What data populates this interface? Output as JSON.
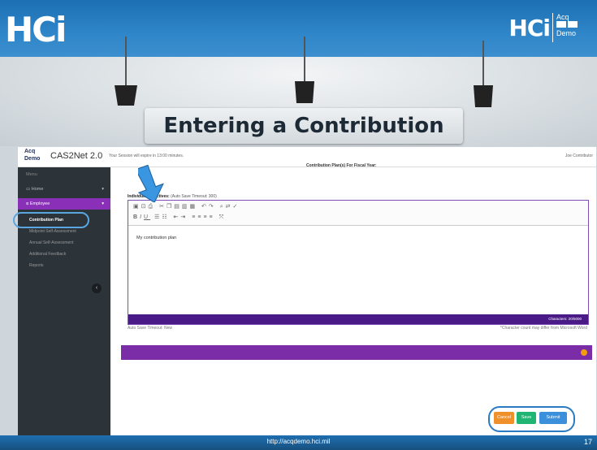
{
  "slide": {
    "logo_left": "HCi",
    "logo_right": "HCi",
    "acq_logo": [
      "Acq",
      "Demo"
    ],
    "title": "Entering a Contribution Plan",
    "footer_url": "http://acqdemo.hci.mil",
    "page_number": "17"
  },
  "app": {
    "logo_text": [
      "Acq",
      "Demo"
    ],
    "name": "CAS2Net 2.0",
    "session_text": "Your Session will expire in 13:00 minutes.",
    "user_name": "Joe Contributor",
    "sidebar": {
      "menu_label": "Menu",
      "items": [
        {
          "label": "Home",
          "icon": "monitor-icon"
        },
        {
          "label": "Employee",
          "icon": "person-icon"
        }
      ],
      "sub_items": [
        "Contribution Plan",
        "Midpoint Self-Assessment",
        "Annual Self-Assessment",
        "Additional Feedback",
        "Reports"
      ]
    },
    "main": {
      "plan_header": "Contribution Plan(s) For Fiscal Year:",
      "objectives_label": "Individual Objectives:",
      "autosave_timeout": "(Auto Save Timeout: 300)",
      "editor_text": "My contribution plan",
      "characters": "Characters: 20/5000",
      "autosave_status": "Auto Save Timeout: New",
      "char_note": "*Character count may differ from Microsoft Word"
    },
    "buttons": {
      "cancel": "Cancel",
      "save": "Save",
      "submit": "Submit"
    }
  },
  "colors": {
    "banner_blue": "#1c6fb3",
    "sidebar_dark": "#2c3339",
    "accent_purple": "#8a2fb7",
    "editor_footer": "#4a1b87",
    "cancel": "#f0902a",
    "save": "#21b573",
    "submit": "#3b8fdb",
    "highlight_circle": "#2b7bc2"
  }
}
